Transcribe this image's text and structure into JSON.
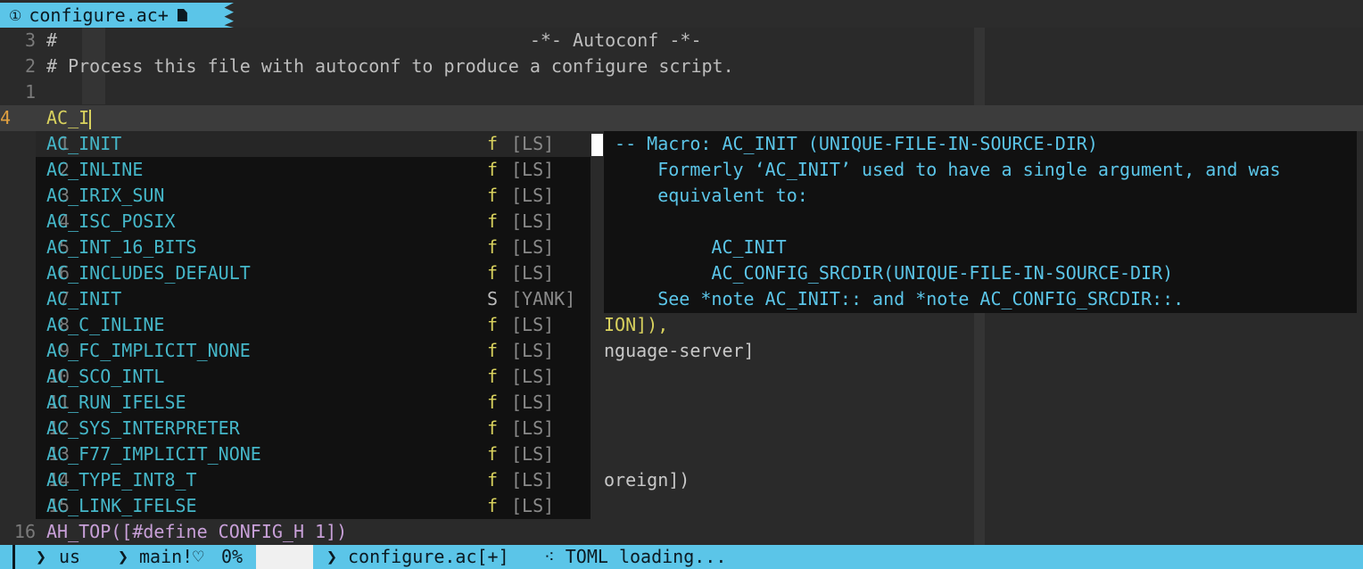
{
  "tab": {
    "number": "①",
    "title": "configure.ac+"
  },
  "editor": {
    "lines": [
      {
        "num": "3",
        "text": "#                                            -*- Autoconf -*-"
      },
      {
        "num": "2",
        "text": "# Process this file with autoconf to produce a configure script."
      },
      {
        "num": "1",
        "text": ""
      },
      {
        "num": "4",
        "text": "AC_I"
      }
    ],
    "partial_lines": [
      {
        "text": "ION]),"
      },
      {
        "text": "nguage-server]"
      },
      {
        "text": "oreign])"
      }
    ],
    "last_line": {
      "num": "16",
      "text": "AH_TOP([#define CONFIG_H 1])"
    }
  },
  "completion": {
    "items": [
      {
        "num": "1",
        "prefix": "AC_I",
        "rest": "NIT",
        "kind": "f",
        "source": "[LS]"
      },
      {
        "num": "2",
        "prefix": "AC_I",
        "rest": "NLINE",
        "kind": "f",
        "source": "[LS]"
      },
      {
        "num": "3",
        "prefix": "AC_I",
        "rest": "RIX_SUN",
        "kind": "f",
        "source": "[LS]"
      },
      {
        "num": "4",
        "prefix": "AC_I",
        "rest": "SC_POSIX",
        "kind": "f",
        "source": "[LS]"
      },
      {
        "num": "5",
        "prefix": "AC_I",
        "rest": "NT_16_BITS",
        "kind": "f",
        "source": "[LS]"
      },
      {
        "num": "6",
        "prefix": "AC_I",
        "rest": "NCLUDES_DEFAULT",
        "kind": "f",
        "source": "[LS]"
      },
      {
        "num": "7",
        "prefix": "AC_I",
        "rest": "NIT",
        "kind": "S",
        "source": "[YANK]"
      },
      {
        "num": "8",
        "prefix": "AC_C_I",
        "rest": "NLINE",
        "kind": "f",
        "source": "[LS]"
      },
      {
        "num": "9",
        "prefix": "AC_FC_I",
        "rest": "MPLICIT_NONE",
        "kind": "f",
        "source": "[LS]"
      },
      {
        "num": "10",
        "prefix": "AC_SCO_I",
        "rest": "NTL",
        "kind": "f",
        "source": "[LS]"
      },
      {
        "num": "11",
        "prefix": "AC_RUN_I",
        "rest": "FELSE",
        "kind": "f",
        "source": "[LS]"
      },
      {
        "num": "12",
        "prefix": "AC_SYS_I",
        "rest": "NTERPRETER",
        "kind": "f",
        "source": "[LS]"
      },
      {
        "num": "13",
        "prefix": "AC_F77_I",
        "rest": "MPLICIT_NONE",
        "kind": "f",
        "source": "[LS]"
      },
      {
        "num": "14",
        "prefix": "AC_TYPE_I",
        "rest": "NT8_T",
        "kind": "f",
        "source": "[LS]"
      },
      {
        "num": "15",
        "prefix": "AC_LINK_I",
        "rest": "FELSE",
        "kind": "f",
        "source": "[LS]"
      }
    ]
  },
  "docs": {
    "lines": [
      " -- Macro: AC_INIT (UNIQUE-FILE-IN-SOURCE-DIR)",
      "     Formerly ‘AC_INIT’ used to have a single argument, and was",
      "     equivalent to:",
      "",
      "          AC_INIT",
      "          AC_CONFIG_SRCDIR(UNIQUE-FILE-IN-SOURCE-DIR)",
      "     See *note AC_INIT:: and *note AC_CONFIG_SRCDIR::."
    ]
  },
  "status": {
    "keymap": "us",
    "branch": "main!♡",
    "percent": "0%",
    "file": "configure.ac[+]",
    "message": "⁖ TOML loading..."
  },
  "colors": {
    "accent": "#5bc5e8",
    "completion_label": "#45b7c9",
    "kind_function": "#d9d25e",
    "cursor_line_number": "#e0a040"
  }
}
